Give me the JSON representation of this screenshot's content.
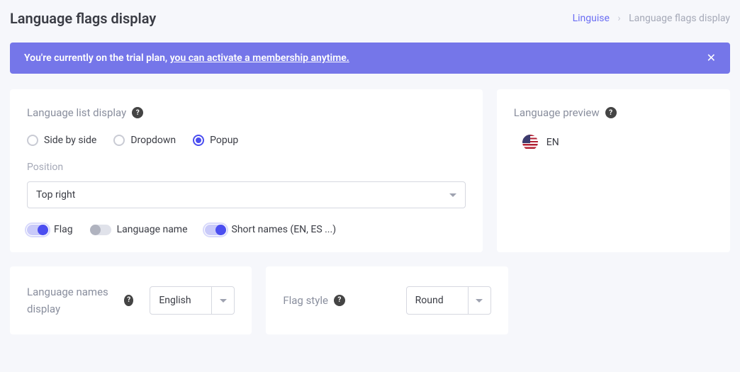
{
  "header": {
    "title": "Language flags display",
    "breadcrumb": {
      "root": "Linguise",
      "current": "Language flags display"
    }
  },
  "banner": {
    "text_prefix": "You're currently on the trial plan, ",
    "text_link": "you can activate a membership anytime."
  },
  "display_section": {
    "title": "Language list display",
    "radios": {
      "side_by_side": "Side by side",
      "dropdown": "Dropdown",
      "popup": "Popup",
      "selected": "popup"
    },
    "position": {
      "label": "Position",
      "value": "Top right"
    },
    "toggles": {
      "flag": {
        "label": "Flag",
        "on": true
      },
      "name": {
        "label": "Language name",
        "on": false
      },
      "short": {
        "label": "Short names (EN, ES ...)",
        "on": true
      }
    }
  },
  "preview": {
    "title": "Language preview",
    "lang_code": "EN"
  },
  "names_display": {
    "title": "Language names display",
    "value": "English"
  },
  "flag_style": {
    "title": "Flag style",
    "value": "Round"
  }
}
